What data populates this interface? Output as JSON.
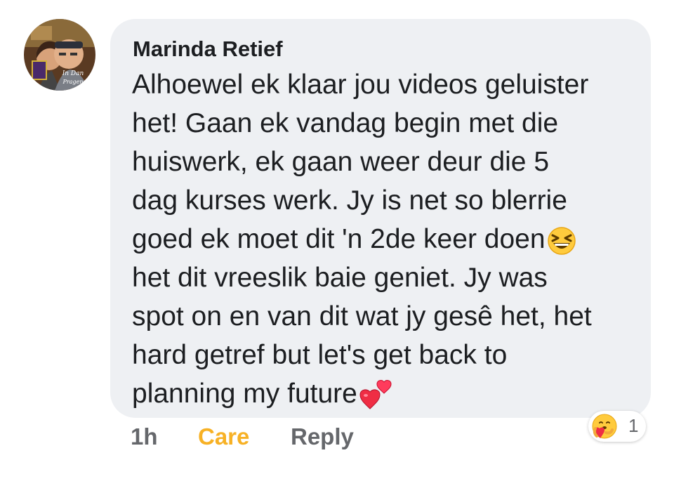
{
  "avatar": {
    "icon": "profile-photo",
    "overlay_text": "In Dan Pragens"
  },
  "comment": {
    "author": "Marinda Retief",
    "lines": [
      "Alhoewel ek klaar jou videos geluister",
      "het! Gaan ek vandag begin met die",
      "huiswerk, ek gaan weer deur die 5",
      "dag kurses werk. Jy is net so blerrie",
      "goed ek moet dit 'n 2de keer doen",
      "het dit vreeslik baie geniet. Jy was",
      "spot on en van dit wat jy gesê het, het",
      "hard getref but let's get back to",
      "planning my future"
    ],
    "emojis": {
      "line_5": "laughing-squint-emoji",
      "line_9": "two-hearts-emoji"
    }
  },
  "actions": {
    "time": "1h",
    "care": "Care",
    "reply": "Reply"
  },
  "reactions": {
    "icon": "care-reaction-icon",
    "count": "1"
  },
  "colors": {
    "bubble": "#eef0f3",
    "text": "#1c1e21",
    "muted": "#65676b",
    "care": "#f7b125"
  }
}
